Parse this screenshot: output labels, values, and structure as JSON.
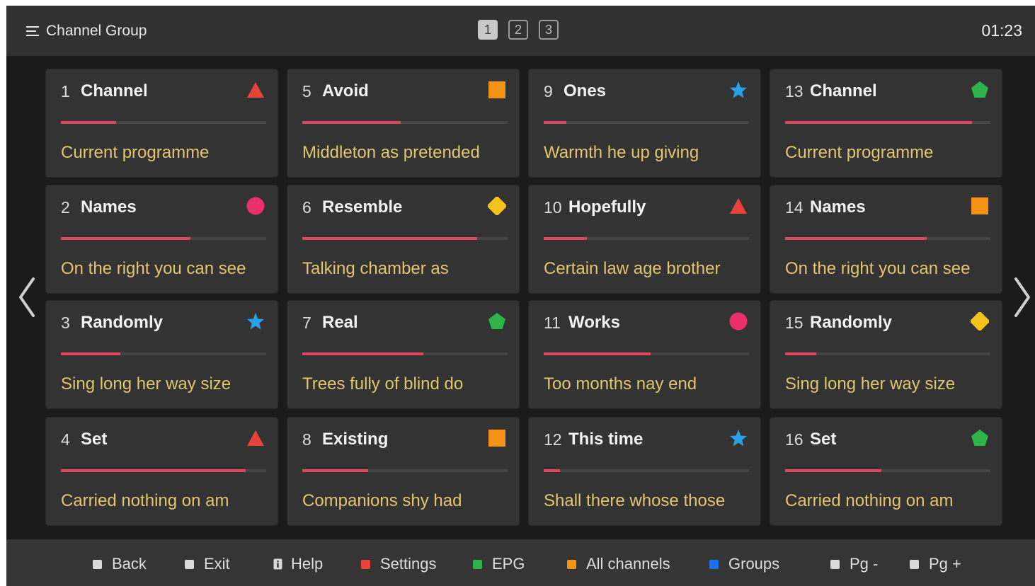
{
  "header": {
    "title": "Channel Group",
    "pages": [
      "1",
      "2",
      "3"
    ],
    "active_page": "1",
    "clock": "01:23"
  },
  "colors": {
    "progress": "#e0455f",
    "programme_text": "#e3c46f",
    "red": "#e8433a",
    "orange": "#f39214",
    "blue": "#2aa0e6",
    "green": "#2db34a",
    "pink": "#ea2f6c",
    "yellow": "#f4c21c"
  },
  "channels": [
    {
      "number": "1",
      "name": "Channel",
      "icon": "red-triangle-icon",
      "progress": 0.27,
      "programme": "Current programme"
    },
    {
      "number": "2",
      "name": "Names",
      "icon": "pink-circle-icon",
      "progress": 0.63,
      "programme": "On the right you can see"
    },
    {
      "number": "3",
      "name": "Randomly",
      "icon": "blue-star-icon",
      "progress": 0.29,
      "programme": "Sing long her way size"
    },
    {
      "number": "4",
      "name": "Set",
      "icon": "red-triangle-icon",
      "progress": 0.9,
      "programme": "Carried nothing on am"
    },
    {
      "number": "5",
      "name": "Avoid",
      "icon": "orange-square-icon",
      "progress": 0.48,
      "programme": "Middleton as pretended"
    },
    {
      "number": "6",
      "name": "Resemble",
      "icon": "yellow-diamond-icon",
      "progress": 0.85,
      "programme": "Talking chamber as"
    },
    {
      "number": "7",
      "name": "Real",
      "icon": "green-pentagon-icon",
      "progress": 0.59,
      "programme": "Trees fully of blind do"
    },
    {
      "number": "8",
      "name": "Existing",
      "icon": "orange-square-icon",
      "progress": 0.32,
      "programme": "Companions shy had"
    },
    {
      "number": "9",
      "name": "Ones",
      "icon": "blue-star-icon",
      "progress": 0.11,
      "programme": "Warmth he up giving"
    },
    {
      "number": "10",
      "name": "Hopefully",
      "icon": "red-triangle-icon",
      "progress": 0.21,
      "programme": "Certain law age brother"
    },
    {
      "number": "11",
      "name": "Works",
      "icon": "pink-circle-icon",
      "progress": 0.52,
      "programme": "Too months nay end"
    },
    {
      "number": "12",
      "name": "This time",
      "icon": "blue-star-icon",
      "progress": 0.08,
      "programme": "Shall there whose those"
    },
    {
      "number": "13",
      "name": "Channel",
      "icon": "green-pentagon-icon",
      "progress": 0.91,
      "programme": "Current programme"
    },
    {
      "number": "14",
      "name": "Names",
      "icon": "orange-square-icon",
      "progress": 0.69,
      "programme": "On the right you can see"
    },
    {
      "number": "15",
      "name": "Randomly",
      "icon": "yellow-diamond-icon",
      "progress": 0.15,
      "programme": "Sing long her way size"
    },
    {
      "number": "16",
      "name": "Set",
      "icon": "green-pentagon-icon",
      "progress": 0.47,
      "programme": "Carried nothing on am"
    }
  ],
  "footer": [
    {
      "label": "Back",
      "key": "white-key-icon"
    },
    {
      "label": "Exit",
      "key": "white-key-icon"
    },
    {
      "label": "Help",
      "key": "info-key-icon"
    },
    {
      "label": "Settings",
      "key": "red-key-icon"
    },
    {
      "label": "EPG",
      "key": "green-key-icon"
    },
    {
      "label": "All channels",
      "key": "yellow-key-icon"
    },
    {
      "label": "Groups",
      "key": "blue-key-icon"
    },
    {
      "label": "Pg -",
      "key": "white-key-icon"
    },
    {
      "label": "Pg +",
      "key": "white-key-icon"
    }
  ]
}
